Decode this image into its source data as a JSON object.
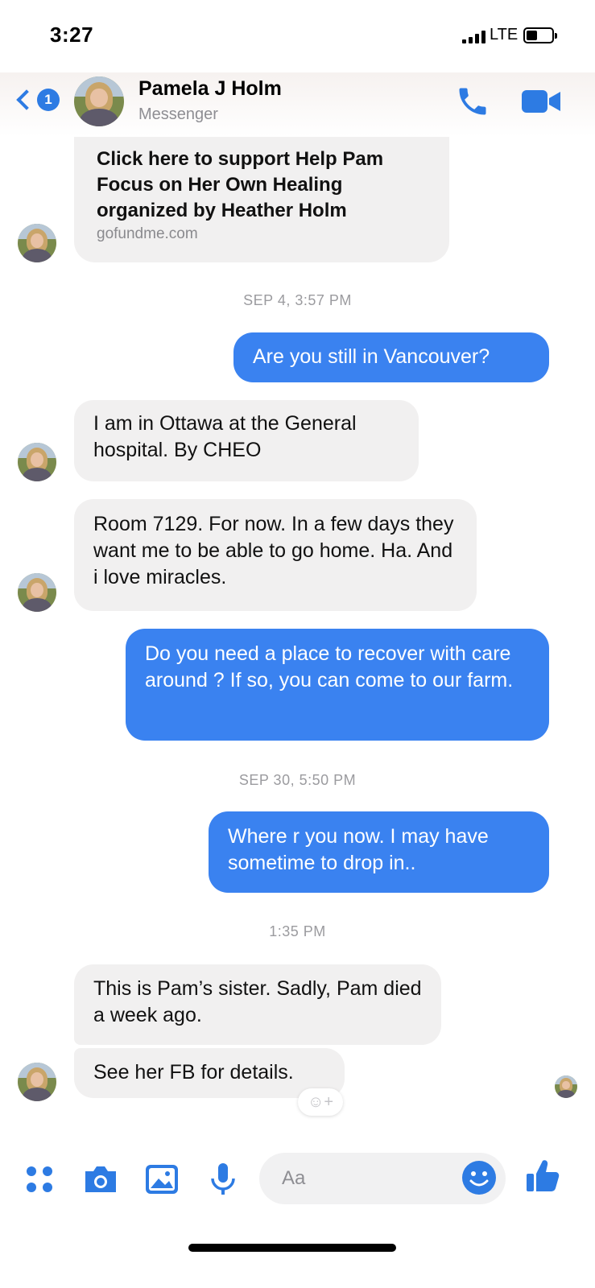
{
  "status": {
    "time": "3:27",
    "network": "LTE"
  },
  "header": {
    "back_badge": "1",
    "contact_name": "Pamela J Holm",
    "subtitle": "Messenger"
  },
  "link_card": {
    "title": "Click here to support Help Pam Focus on Her Own Healing organized by Heather Holm",
    "domain": "gofundme.com"
  },
  "timestamps": [
    "SEP 4, 3:57 PM",
    "SEP 30, 5:50 PM",
    "1:35 PM"
  ],
  "messages": [
    {
      "text": "Are you still in Vancouver?",
      "sender": "me"
    },
    {
      "text": "I am in Ottawa at the General hospital. By CHEO",
      "sender": "them"
    },
    {
      "text": "Room 7129. For now. In a few days they want me to be able to go home. Ha. And i love miracles.",
      "sender": "them"
    },
    {
      "text": "Do you need a place to recover with care around ? If so, you can come to our farm.",
      "sender": "me"
    },
    {
      "text": "Where r you now. I may have sometime to drop in..",
      "sender": "me"
    },
    {
      "text": "This is Pam’s sister. Sadly, Pam died a week ago.",
      "sender": "them"
    },
    {
      "text": "See her FB for details.",
      "sender": "them"
    }
  ],
  "composer": {
    "placeholder": "Aa"
  },
  "icons": {
    "back": "chevron-left-icon",
    "call": "phone-icon",
    "video": "video-camera-icon",
    "more": "four-dots-icon",
    "camera": "camera-icon",
    "gallery": "image-icon",
    "mic": "microphone-icon",
    "emoji": "smiley-icon",
    "like": "thumbs-up-icon",
    "reaction": "add-reaction-icon"
  },
  "colors": {
    "accent": "#3a82f0",
    "incoming_bubble": "#f1f0f0"
  }
}
